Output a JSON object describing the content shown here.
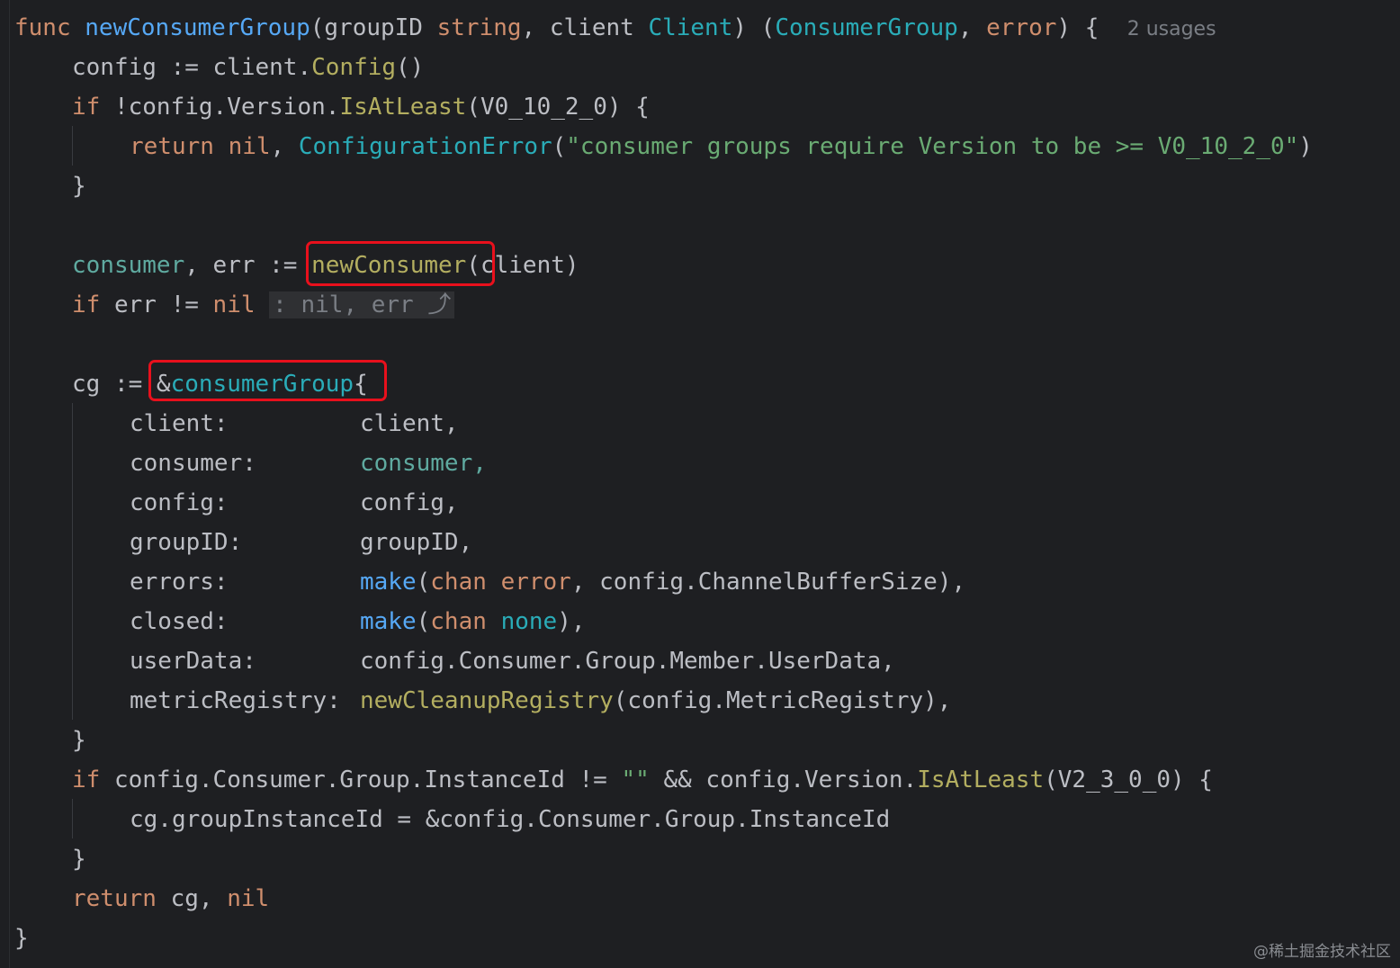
{
  "header": {
    "k_func": "func",
    "func_name": "newConsumerGroup",
    "p_open": "(",
    "param1": "groupID",
    "param1_type": "string",
    "comma1": ",",
    "param2": "client",
    "param2_type": "Client",
    "p_close": ")",
    "ret_open": "(",
    "ret1": "ConsumerGroup",
    "comma2": ",",
    "ret2": "error",
    "ret_close": ")",
    "brace": "{",
    "usages": "2 usages"
  },
  "l2": {
    "a": "config := client.",
    "b": "Config",
    "c": "()"
  },
  "l3": {
    "if": "if",
    "a": " !config.Version.",
    "b": "IsAtLeast",
    "c": "(V0_10_2_0) {"
  },
  "l4": {
    "ret": "return",
    "nil": "nil",
    "sep": ", ",
    "fn": "ConfigurationError",
    "open": "(",
    "str": "\"consumer groups require Version to be >= V0_10_2_0\"",
    "close": ")"
  },
  "l5": {
    "brace": "}"
  },
  "l7": {
    "consumer": "consumer",
    "rest": ", err := ",
    "fn": "newConsumer",
    "args": "(client)"
  },
  "l8": {
    "if": "if",
    "a": " err != ",
    "nil": "nil",
    "hint": ": nil, err ⤴"
  },
  "l10": {
    "a": "cg := ",
    "amp": "&",
    "type": "consumerGroup",
    "brace": "{"
  },
  "fields": [
    {
      "key": "client:",
      "value": "client,"
    },
    {
      "key": "consumer:",
      "value": "consumer,"
    },
    {
      "key": "config:",
      "value": "config,"
    },
    {
      "key": "groupID:",
      "value": "groupID,"
    }
  ],
  "errors_field": {
    "key": "errors:",
    "make": "make",
    "open": "(",
    "chan": "chan",
    "err": "error",
    "rest": ", config.ChannelBufferSize),"
  },
  "closed_field": {
    "key": "closed:",
    "make": "make",
    "open": "(",
    "chan": "chan",
    "none": "none",
    "rest": "),"
  },
  "userdata_field": {
    "key": "userData:",
    "value": "config.Consumer.Group.Member.UserData,"
  },
  "metric_field": {
    "key": "metricRegistry:",
    "fn": "newCleanupRegistry",
    "rest": "(config.MetricRegistry),"
  },
  "l20": {
    "brace": "}"
  },
  "l21": {
    "if": "if",
    "a": " config.Consumer.Group.InstanceId != ",
    "str": "\"\"",
    "b": " && config.Version.",
    "fn": "IsAtLeast",
    "c": "(V2_3_0_0) {"
  },
  "l22": {
    "a": "cg.groupInstanceId = &config.Consumer.Group.InstanceId"
  },
  "l23": {
    "brace": "}"
  },
  "l24": {
    "ret": "return",
    "a": " cg, ",
    "nil": "nil"
  },
  "l25": {
    "brace": "}"
  },
  "watermark": "@稀土掘金技术社区"
}
